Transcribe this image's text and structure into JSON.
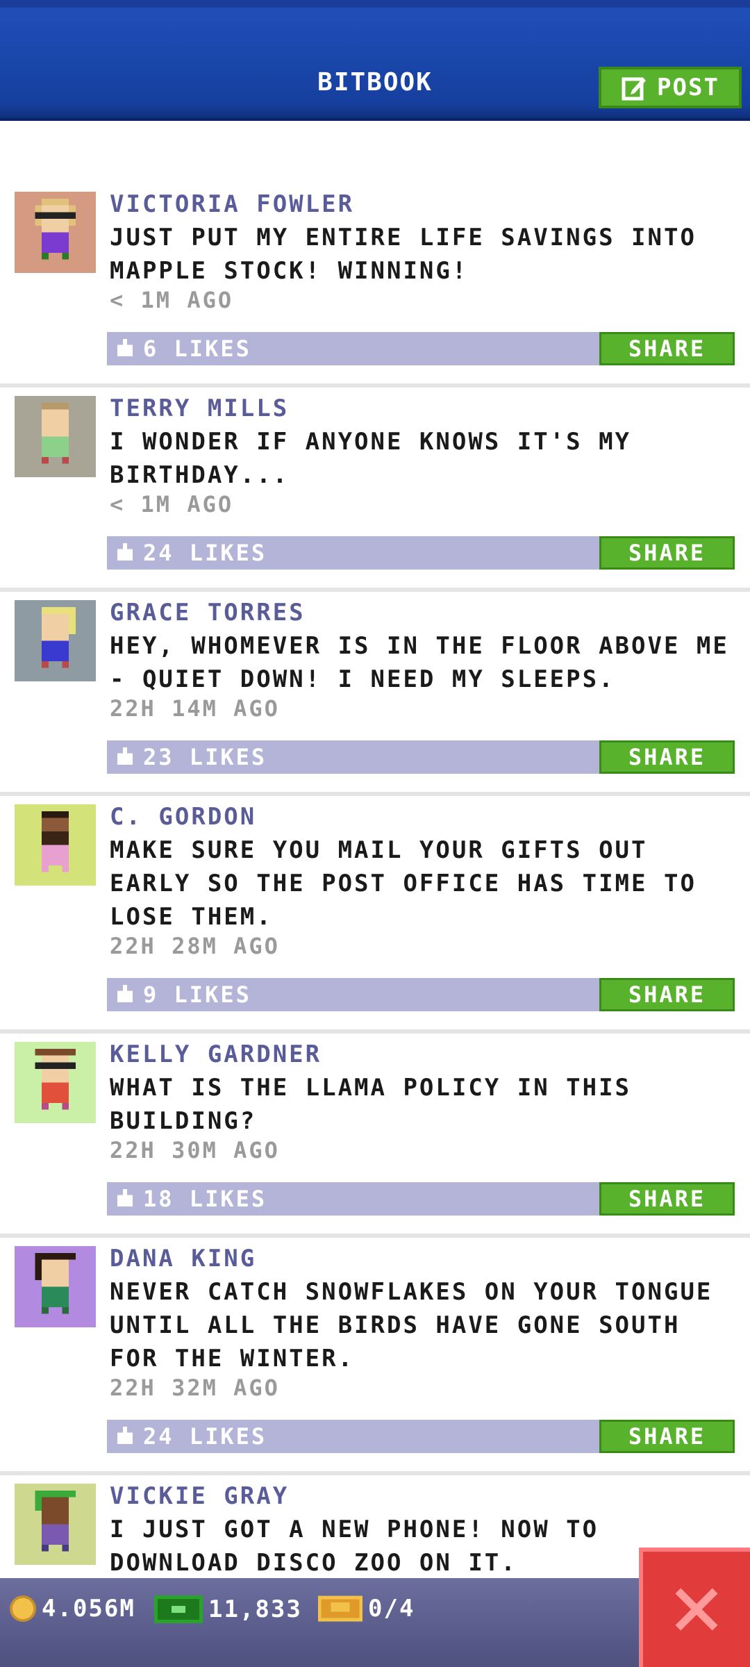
{
  "header": {
    "title": "BITBOOK",
    "post_label": "POST",
    "post_icon": "edit-icon"
  },
  "feed": {
    "posts": [
      {
        "author": "VICTORIA FOWLER",
        "text": "JUST PUT MY ENTIRE LIFE SAVINGS INTO MAPPLE STOCK! WINNING!",
        "time": "< 1M AGO",
        "likes": "6 LIKES",
        "share_label": "SHARE",
        "avatar_bg": "#d49a82"
      },
      {
        "author": "TERRY MILLS",
        "text": "I WONDER IF ANYONE KNOWS IT'S MY BIRTHDAY...",
        "time": "< 1M AGO",
        "likes": "24 LIKES",
        "share_label": "SHARE",
        "avatar_bg": "#a9a596"
      },
      {
        "author": "GRACE TORRES",
        "text": "HEY, WHOMEVER IS IN THE FLOOR ABOVE ME - QUIET DOWN! I NEED MY SLEEPS.",
        "time": "22H 14M AGO",
        "likes": "23 LIKES",
        "share_label": "SHARE",
        "avatar_bg": "#8f9ba3"
      },
      {
        "author": "C. GORDON",
        "text": "MAKE SURE YOU MAIL YOUR GIFTS OUT EARLY SO THE POST OFFICE HAS TIME TO LOSE THEM.",
        "time": "22H 28M AGO",
        "likes": "9 LIKES",
        "share_label": "SHARE",
        "avatar_bg": "#d4e27a"
      },
      {
        "author": "KELLY GARDNER",
        "text": "WHAT IS THE LLAMA POLICY IN THIS BUILDING?",
        "time": "22H 30M AGO",
        "likes": "18 LIKES",
        "share_label": "SHARE",
        "avatar_bg": "#c9f0a6"
      },
      {
        "author": "DANA KING",
        "text": "NEVER CATCH SNOWFLAKES ON YOUR TONGUE UNTIL ALL THE BIRDS HAVE GONE SOUTH FOR THE WINTER.",
        "time": "22H 32M AGO",
        "likes": "24 LIKES",
        "share_label": "SHARE",
        "avatar_bg": "#b28be0"
      },
      {
        "author": "VICKIE GRAY",
        "text": "I JUST GOT A NEW PHONE! NOW TO DOWNLOAD DISCO ZOO ON IT.",
        "avatar_bg": "#cfd88f"
      }
    ]
  },
  "bottom_bar": {
    "coins": "4.056M",
    "bux": "11,833",
    "tickets": "0/4",
    "coin_icon": "coin-icon",
    "bux_icon": "bux-icon",
    "ticket_icon": "ticket-icon",
    "close_icon": "close-icon"
  },
  "colors": {
    "header_blue": "#163f9e",
    "accent_green": "#58b22c",
    "likes_bar": "#b3b4d8",
    "author_text": "#5a5c9a",
    "close_red": "#e23b3b"
  }
}
